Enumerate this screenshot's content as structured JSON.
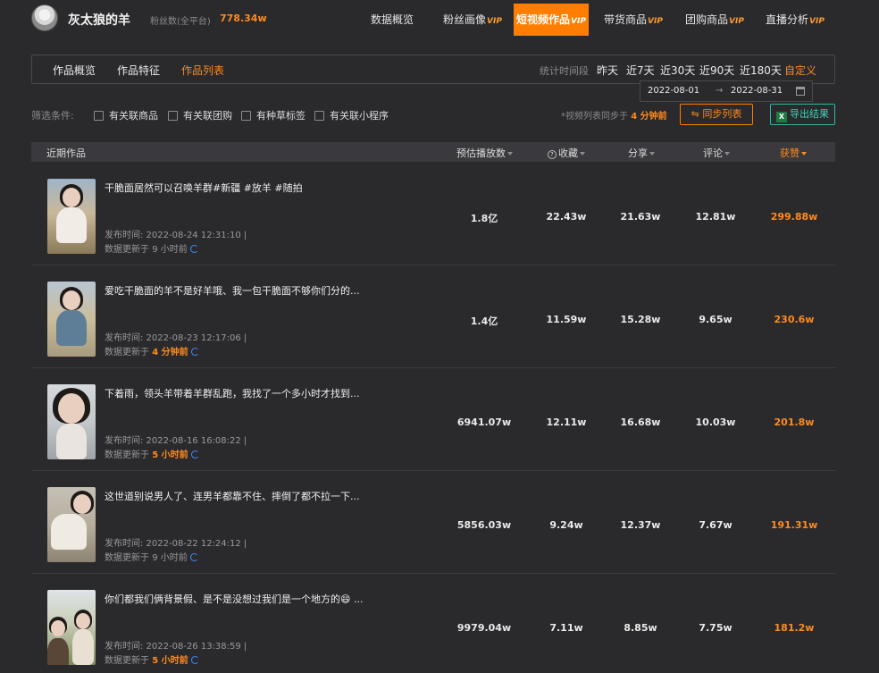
{
  "account": {
    "name": "灰太狼的羊",
    "fans_label": "粉丝数(全平台)",
    "fans_value": "778.34w"
  },
  "nav": [
    {
      "label": "数据概览",
      "vip": ""
    },
    {
      "label": "粉丝画像",
      "vip": "VIP"
    },
    {
      "label": "短视频作品",
      "vip": "VIP"
    },
    {
      "label": "带货商品",
      "vip": "VIP"
    },
    {
      "label": "团购商品",
      "vip": "VIP"
    },
    {
      "label": "直播分析",
      "vip": "VIP"
    }
  ],
  "subtabs": [
    "作品概览",
    "作品特征",
    "作品列表"
  ],
  "period": {
    "label": "统计时间段",
    "options": [
      "昨天",
      "近7天",
      "近30天",
      "近90天",
      "近180天",
      "自定义"
    ],
    "start": "2022-08-01",
    "arrow": "→",
    "end": "2022-08-31"
  },
  "filter": {
    "label": "筛选条件:",
    "options": [
      "有关联商品",
      "有关联团购",
      "有种草标签",
      "有关联小程序"
    ],
    "sync_prefix": "*视频列表同步于",
    "sync_time": "4 分钟前",
    "sync_button": "⇋ 同步列表",
    "export_button": "导出结果",
    "export_icon_text": "X"
  },
  "table": {
    "headers": [
      "近期作品",
      "预估播放数",
      "收藏",
      "分享",
      "评论",
      "获赞"
    ],
    "info_icon_text": "?",
    "rows": [
      {
        "title": "干脆面居然可以召唤羊群#新疆 #放羊 #随拍",
        "time": "发布时间:  2022-08-24 12:31:10  |",
        "update_prefix": "数据更新于",
        "update_time": "9 小时前",
        "plays": "1.8亿",
        "favs": "22.43w",
        "shares": "21.63w",
        "comments": "12.81w",
        "likes": "299.88w"
      },
      {
        "title": "爱吃干脆面的羊不是好羊哦、我一包干脆面不够你们分的...",
        "time": "发布时间:  2022-08-23 12:17:06  |",
        "update_prefix": "数据更新于",
        "update_time": "4 分钟前",
        "plays": "1.4亿",
        "favs": "11.59w",
        "shares": "15.28w",
        "comments": "9.65w",
        "likes": "230.6w"
      },
      {
        "title": "下着雨，领头羊带着羊群乱跑，我找了一个多小时才找到...",
        "time": "发布时间:  2022-08-16 16:08:22  |",
        "update_prefix": "数据更新于",
        "update_time": "5 小时前",
        "plays": "6941.07w",
        "favs": "12.11w",
        "shares": "16.68w",
        "comments": "10.03w",
        "likes": "201.8w"
      },
      {
        "title": "这世道别说男人了、连男羊都靠不住、摔倒了都不拉一下...",
        "time": "发布时间:  2022-08-22 12:24:12  |",
        "update_prefix": "数据更新于",
        "update_time": "9 小时前",
        "plays": "5856.03w",
        "favs": "9.24w",
        "shares": "12.37w",
        "comments": "7.67w",
        "likes": "191.31w"
      },
      {
        "title": "你们都我们俩背景假、是不是没想过我们是一个地方的😄 ...",
        "time": "发布时间:  2022-08-26 13:38:59  |",
        "update_prefix": "数据更新于",
        "update_time": "5 小时前",
        "plays": "9979.04w",
        "favs": "7.11w",
        "shares": "8.85w",
        "comments": "7.75w",
        "likes": "181.2w"
      }
    ]
  },
  "colors": {
    "accent": "#ff7d00",
    "background": "#2a2a2d",
    "export_green": "#2fb8a0",
    "sync_blue": "#3d8cff"
  }
}
